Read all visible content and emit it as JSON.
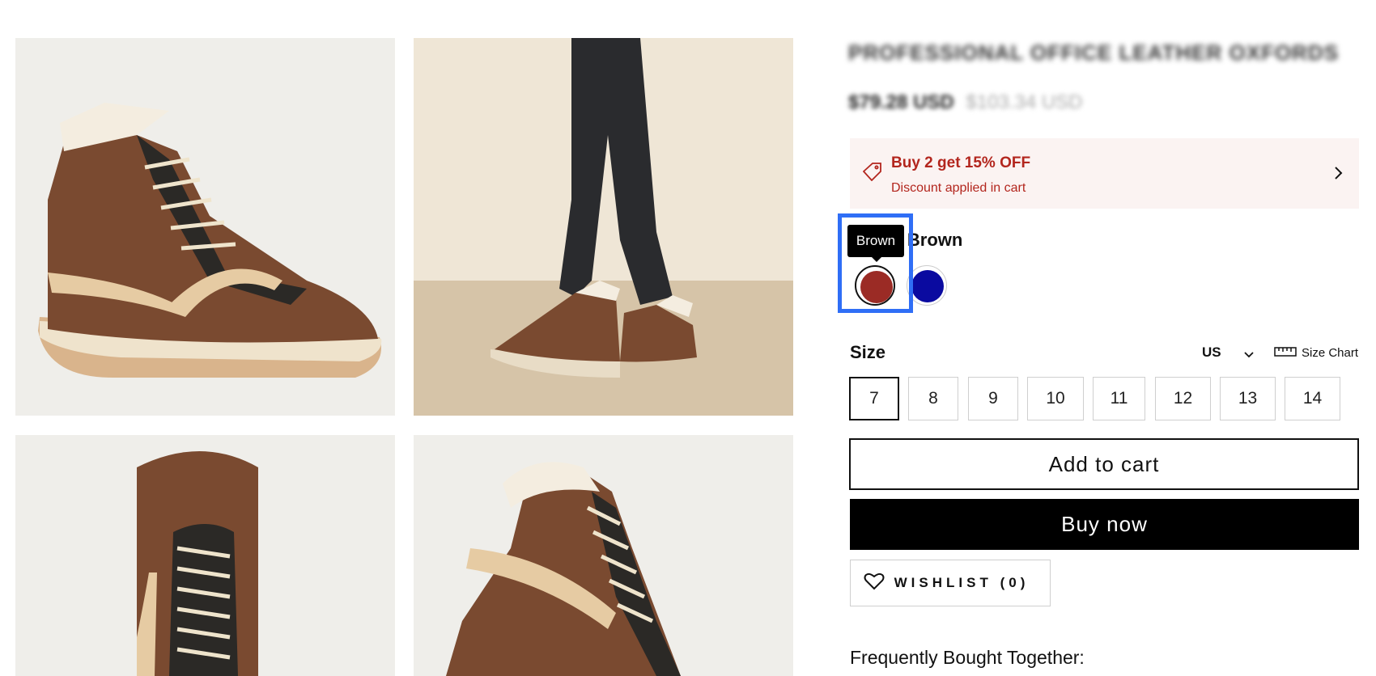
{
  "product": {
    "title": "PROFESSIONAL OFFICE LEATHER OXFORDS",
    "price_now": "$79.28 USD",
    "price_was": "$103.34 USD"
  },
  "promo": {
    "title": "Buy 2 get 15% OFF",
    "subtitle": "Discount applied in cart",
    "icon": "tag-icon"
  },
  "color": {
    "label": "Color: Brown",
    "tooltip": "Brown",
    "swatches": [
      {
        "name": "Brown",
        "hex": "#9b2b25",
        "selected": true
      },
      {
        "name": "Blue",
        "hex": "#0a0aa0",
        "selected": false
      }
    ]
  },
  "size": {
    "label": "Size",
    "region": "US",
    "size_chart_label": "Size Chart",
    "options": [
      "7",
      "8",
      "9",
      "10",
      "11",
      "12",
      "13",
      "14"
    ],
    "selected": "7"
  },
  "actions": {
    "add_to_cart": "Add to cart",
    "buy_now": "Buy now",
    "wishlist": "WISHLIST (0)"
  },
  "frequently_bought": "Frequently Bought Together:",
  "colors": {
    "promo_bg": "#fbf3f2",
    "promo_text": "#b3261e",
    "focus": "#2f6ef6"
  }
}
